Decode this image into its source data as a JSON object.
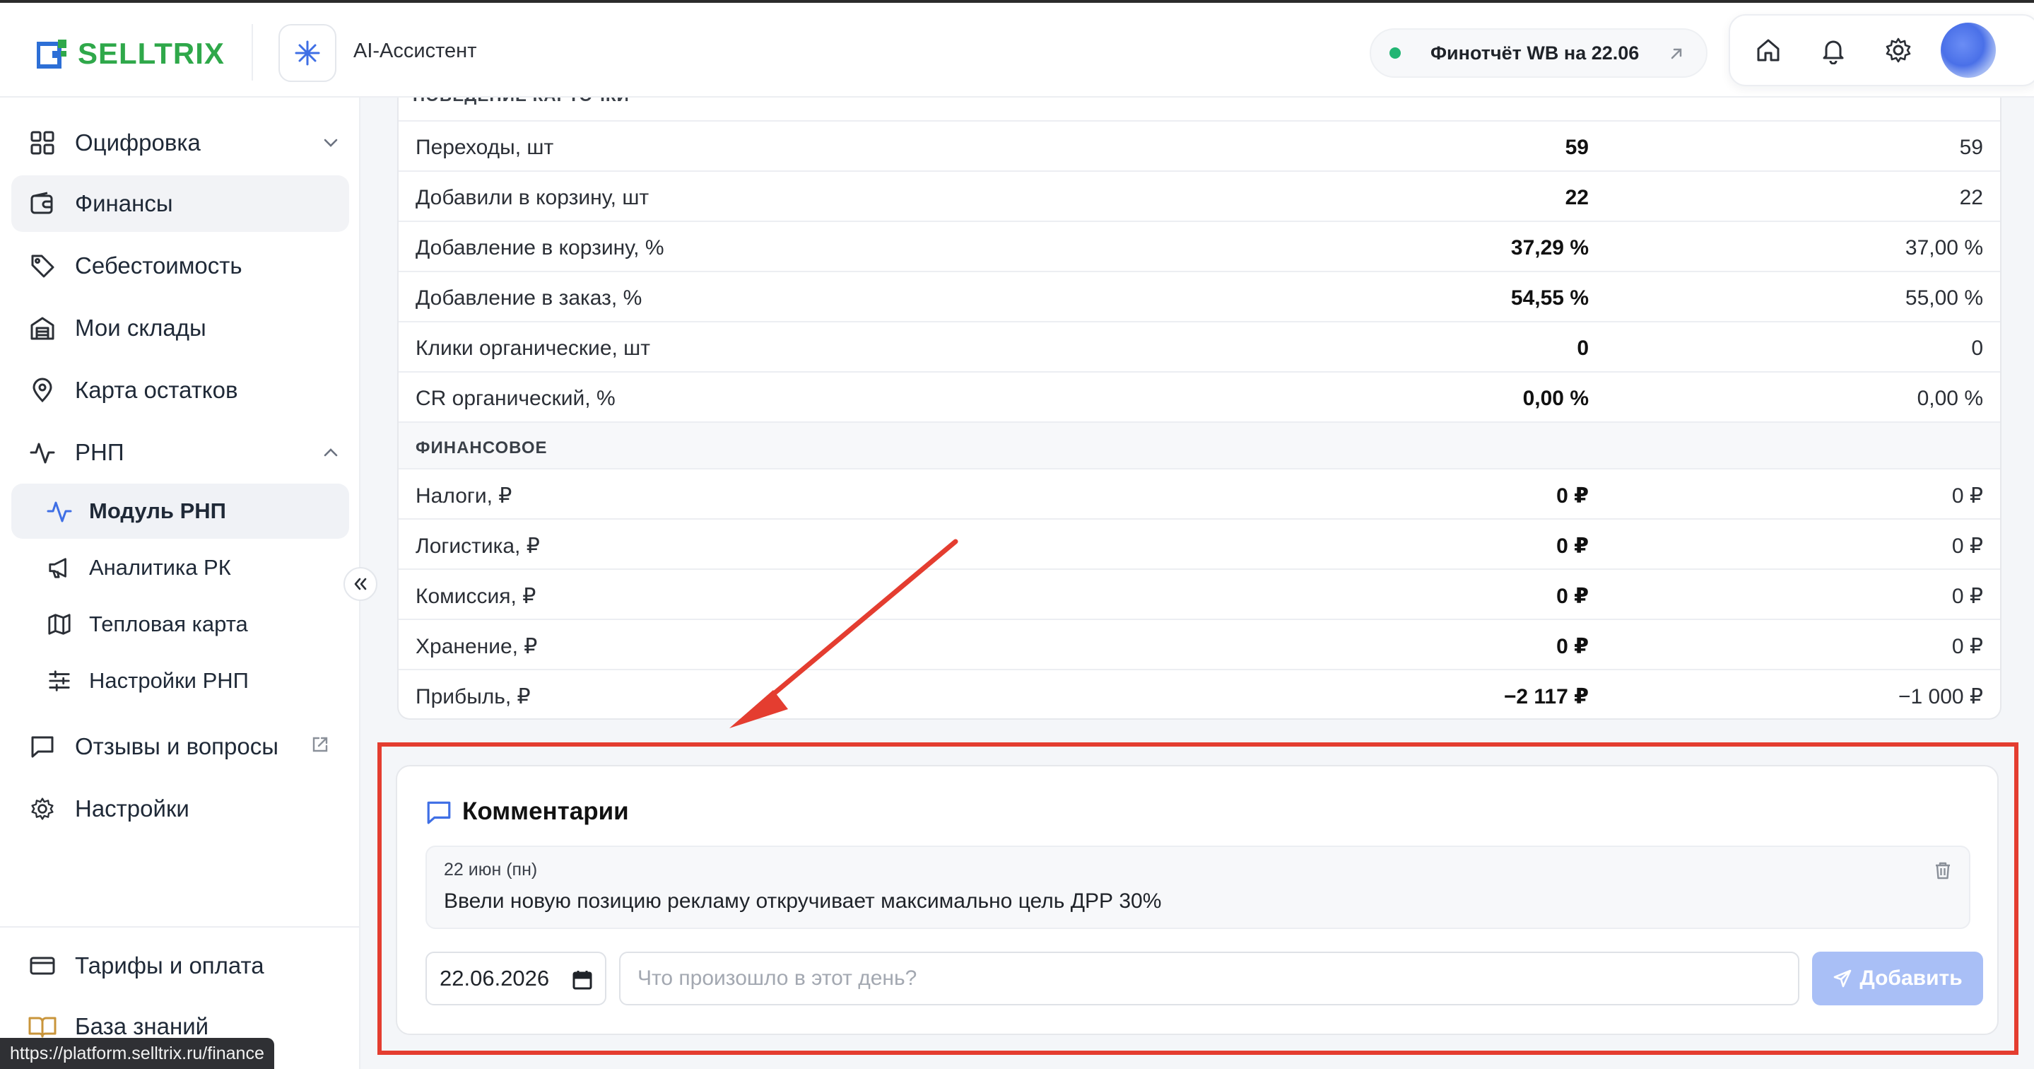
{
  "header": {
    "logo_text": "SELLTRIX",
    "ai_label": "AI-Ассистент",
    "fin_report": "Финотчёт WB на 22.06",
    "colors": {
      "brand_green": "#2fa84a",
      "status_green": "#22b573",
      "accent_blue": "#3f6fe5"
    }
  },
  "sidebar": {
    "items": [
      {
        "label": "Оцифровка",
        "icon": "grid-icon"
      },
      {
        "label": "Финансы",
        "icon": "wallet-icon"
      },
      {
        "label": "Себестоимость",
        "icon": "tag-icon"
      },
      {
        "label": "Мои склады",
        "icon": "warehouse-icon"
      },
      {
        "label": "Карта остатков",
        "icon": "map-pin-icon"
      },
      {
        "label": "РНП",
        "icon": "activity-icon"
      }
    ],
    "sub_items": [
      {
        "label": "Модуль РНП",
        "icon": "activity-icon"
      },
      {
        "label": "Аналитика РК",
        "icon": "megaphone-icon"
      },
      {
        "label": "Тепловая карта",
        "icon": "map-icon"
      },
      {
        "label": "Настройки РНП",
        "icon": "sliders-icon"
      }
    ],
    "items2": [
      {
        "label": "Отзывы и вопросы",
        "icon": "message-icon"
      },
      {
        "label": "Настройки",
        "icon": "gear-icon"
      }
    ],
    "bottom": [
      {
        "label": "Тарифы и оплата",
        "icon": "credit-card-icon"
      },
      {
        "label": "База знаний",
        "icon": "book-icon"
      }
    ],
    "url_tooltip": "https://platform.selltrix.ru/finance"
  },
  "table": {
    "cut_section": "ПОВЕДЕНИЕ КАРТОЧКИ",
    "rows_a": [
      {
        "label": "Переходы, шт",
        "v1": "59",
        "v2": "59"
      },
      {
        "label": "Добавили в корзину, шт",
        "v1": "22",
        "v2": "22"
      },
      {
        "label": "Добавление в корзину, %",
        "v1": "37,29 %",
        "v2": "37,00 %"
      },
      {
        "label": "Добавление в заказ, %",
        "v1": "54,55 %",
        "v2": "55,00 %"
      },
      {
        "label": "Клики органические, шт",
        "v1": "0",
        "v2": "0"
      },
      {
        "label": "CR органический, %",
        "v1": "0,00 %",
        "v2": "0,00 %"
      }
    ],
    "section_fin": "ФИНАНСОВОЕ",
    "rows_b": [
      {
        "label": "Налоги, ₽",
        "v1": "0 ₽",
        "v2": "0 ₽"
      },
      {
        "label": "Логистика, ₽",
        "v1": "0 ₽",
        "v2": "0 ₽"
      },
      {
        "label": "Комиссия, ₽",
        "v1": "0 ₽",
        "v2": "0 ₽"
      },
      {
        "label": "Хранение, ₽",
        "v1": "0 ₽",
        "v2": "0 ₽"
      },
      {
        "label": "Прибыль, ₽",
        "v1": "−2 117 ₽",
        "v2": "−1 000 ₽"
      }
    ]
  },
  "comments": {
    "title": "Комментарии",
    "entries": [
      {
        "date": "22 июн (пн)",
        "text": "Ввели новую позицию рекламу откручивает максимально цель ДРР 30%"
      }
    ],
    "date_value": "22.06.2026",
    "placeholder": "Что произошло в этот день?",
    "add_label": "Добавить"
  },
  "annotation": {
    "color": "#e43d30"
  }
}
